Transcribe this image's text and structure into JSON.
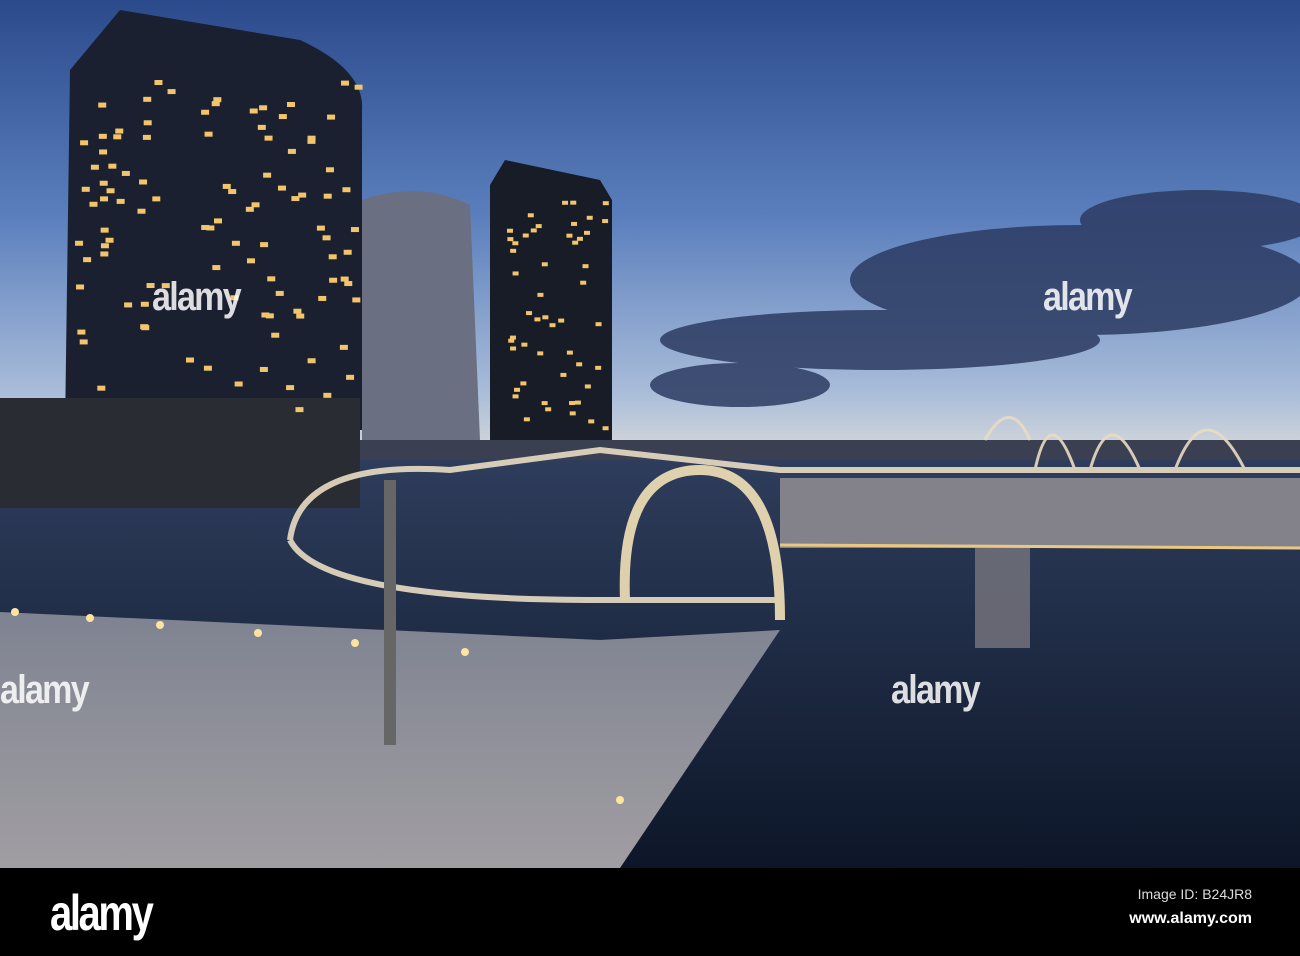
{
  "photo": {
    "subject": "Webb Bridge at dusk",
    "watermark_text": "alamy",
    "colors": {
      "sky_top": "#2d4a86",
      "sky_horizon": "#e9e2d6",
      "water": "#1c2a44",
      "promenade": "#8c8f99",
      "lights": "#ffd98a"
    }
  },
  "footer": {
    "logo": "alamy",
    "image_id": "Image ID: B24JR8",
    "website": "www.alamy.com"
  }
}
